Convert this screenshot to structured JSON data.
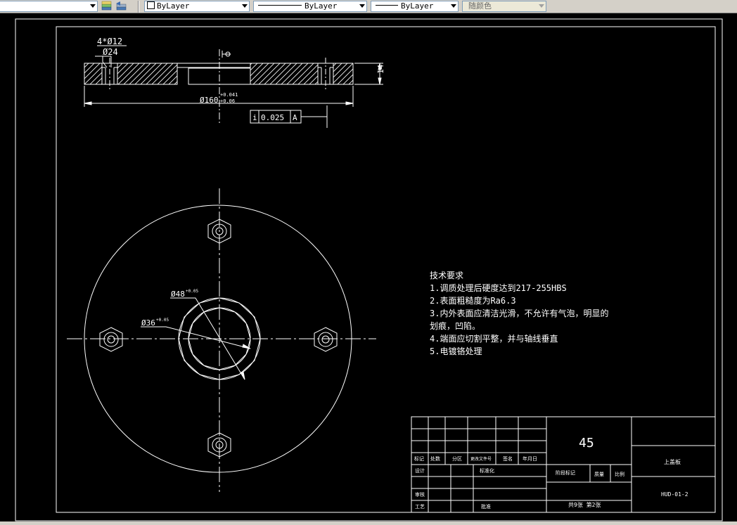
{
  "toolbar": {
    "layer_combo": "ByLayer",
    "linetype_combo": "ByLayer",
    "lineweight_combo": "ByLayer",
    "plotstyle_combo": "随颜色"
  },
  "drawing": {
    "dims": {
      "holes": "4*Ø12",
      "counterbore": "Ø24",
      "thickness": "14",
      "outer_dia": "Ø160",
      "outer_tol_upper": "+0.041",
      "outer_tol_lower": "+0.06",
      "datum": "A"
    },
    "tolerance_frame": {
      "symbol": "i",
      "value": "0.025",
      "datum": "A"
    },
    "inner_dims": {
      "bore48": "Ø48",
      "bore48_tol": "+0.05",
      "bore36": "Ø36",
      "bore36_tol": "+0.05"
    },
    "tech_requirements": {
      "title": "技术要求",
      "items": [
        "1.调质处理后硬度达到217-255HBS",
        "2.表面粗糙度为Ra6.3",
        "3.内外表面应清洁光滑，不允许有气泡，明显的",
        "划痕，凹陷。",
        "4.端面应切割平整，并与轴线垂直",
        "5.电镀铬处理"
      ]
    },
    "title_block": {
      "material": "45",
      "part_name": "上盖板",
      "drawing_no": "HUD-01-2",
      "sheets": "共9张 第2张",
      "row_labels": [
        "标记",
        "处数",
        "分区",
        "更改文件号",
        "签名",
        "年月日"
      ],
      "design": "设计",
      "standardization": "标准化",
      "review": "审核",
      "process": "工艺",
      "approve": "批准",
      "stage_mark": "阶段标记",
      "mass": "质量",
      "scale": "比例"
    }
  }
}
